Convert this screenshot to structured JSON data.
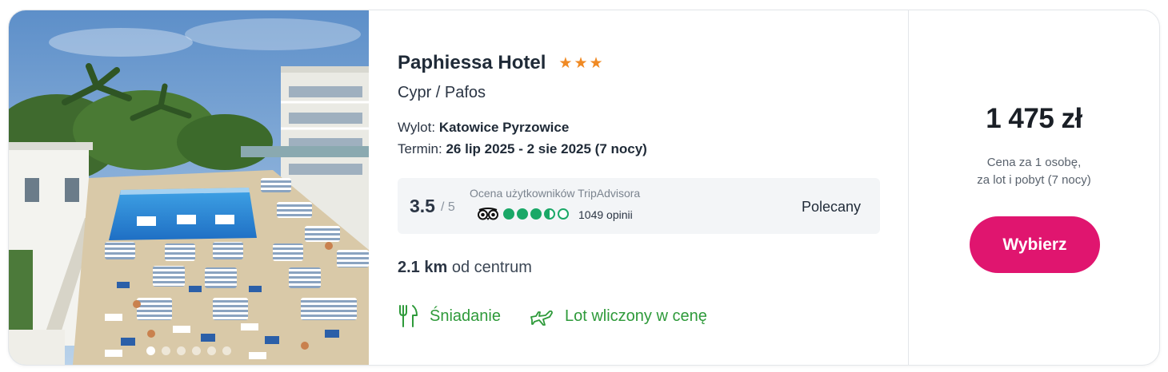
{
  "hotel": {
    "name": "Paphiessa Hotel",
    "stars": 3,
    "location": "Cypr / Pafos",
    "flight_label": "Wylot:",
    "flight_value": "Katowice Pyrzowice",
    "term_label": "Termin:",
    "term_value": "26 lip 2025 - 2 sie 2025 (7 nocy)",
    "photo_count": 6,
    "photo_active_index": 0
  },
  "rating": {
    "score": "3.5",
    "scale": "/ 5",
    "source_label": "Ocena użytkowników TripAdvisora",
    "bubbles": 3.5,
    "reviews": "1049 opinii",
    "badge": "Polecany",
    "bubble_color": "#1aa867"
  },
  "distance": {
    "value": "2.1 km",
    "label": "od centrum"
  },
  "features": [
    {
      "icon": "cutlery-icon",
      "label": "Śniadanie"
    },
    {
      "icon": "plane-icon",
      "label": "Lot wliczony w cenę"
    }
  ],
  "pricing": {
    "price": "1 475 zł",
    "note_line1": "Cena za 1 osobę,",
    "note_line2": "za lot i pobyt (7 nocy)",
    "button_label": "Wybierz",
    "accent_color": "#e0156f"
  },
  "colors": {
    "star": "#f08a24",
    "feature_green": "#2e9a3a"
  }
}
